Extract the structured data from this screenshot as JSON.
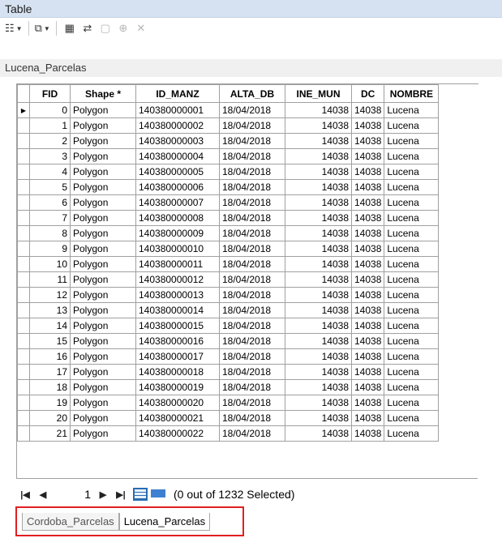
{
  "window": {
    "title": "Table"
  },
  "toolbar": {
    "items": [
      {
        "icon": "table-options-icon"
      },
      {
        "icon": "related-tables-icon"
      },
      {
        "icon": "select-by-attributes-icon"
      },
      {
        "icon": "switch-selection-icon"
      },
      {
        "icon": "clear-selection-icon"
      },
      {
        "icon": "zoom-to-selected-icon"
      },
      {
        "icon": "delete-selected-icon"
      }
    ]
  },
  "sheet": {
    "name": "Lucena_Parcelas"
  },
  "table": {
    "columns": [
      "FID",
      "Shape *",
      "ID_MANZ",
      "ALTA_DB",
      "INE_MUN",
      "DC",
      "NOMBRE"
    ],
    "rows": [
      [
        "0",
        "Polygon",
        "140380000001",
        "18/04/2018",
        "14038",
        "14038",
        "Lucena"
      ],
      [
        "1",
        "Polygon",
        "140380000002",
        "18/04/2018",
        "14038",
        "14038",
        "Lucena"
      ],
      [
        "2",
        "Polygon",
        "140380000003",
        "18/04/2018",
        "14038",
        "14038",
        "Lucena"
      ],
      [
        "3",
        "Polygon",
        "140380000004",
        "18/04/2018",
        "14038",
        "14038",
        "Lucena"
      ],
      [
        "4",
        "Polygon",
        "140380000005",
        "18/04/2018",
        "14038",
        "14038",
        "Lucena"
      ],
      [
        "5",
        "Polygon",
        "140380000006",
        "18/04/2018",
        "14038",
        "14038",
        "Lucena"
      ],
      [
        "6",
        "Polygon",
        "140380000007",
        "18/04/2018",
        "14038",
        "14038",
        "Lucena"
      ],
      [
        "7",
        "Polygon",
        "140380000008",
        "18/04/2018",
        "14038",
        "14038",
        "Lucena"
      ],
      [
        "8",
        "Polygon",
        "140380000009",
        "18/04/2018",
        "14038",
        "14038",
        "Lucena"
      ],
      [
        "9",
        "Polygon",
        "140380000010",
        "18/04/2018",
        "14038",
        "14038",
        "Lucena"
      ],
      [
        "10",
        "Polygon",
        "140380000011",
        "18/04/2018",
        "14038",
        "14038",
        "Lucena"
      ],
      [
        "11",
        "Polygon",
        "140380000012",
        "18/04/2018",
        "14038",
        "14038",
        "Lucena"
      ],
      [
        "12",
        "Polygon",
        "140380000013",
        "18/04/2018",
        "14038",
        "14038",
        "Lucena"
      ],
      [
        "13",
        "Polygon",
        "140380000014",
        "18/04/2018",
        "14038",
        "14038",
        "Lucena"
      ],
      [
        "14",
        "Polygon",
        "140380000015",
        "18/04/2018",
        "14038",
        "14038",
        "Lucena"
      ],
      [
        "15",
        "Polygon",
        "140380000016",
        "18/04/2018",
        "14038",
        "14038",
        "Lucena"
      ],
      [
        "16",
        "Polygon",
        "140380000017",
        "18/04/2018",
        "14038",
        "14038",
        "Lucena"
      ],
      [
        "17",
        "Polygon",
        "140380000018",
        "18/04/2018",
        "14038",
        "14038",
        "Lucena"
      ],
      [
        "18",
        "Polygon",
        "140380000019",
        "18/04/2018",
        "14038",
        "14038",
        "Lucena"
      ],
      [
        "19",
        "Polygon",
        "140380000020",
        "18/04/2018",
        "14038",
        "14038",
        "Lucena"
      ],
      [
        "20",
        "Polygon",
        "140380000021",
        "18/04/2018",
        "14038",
        "14038",
        "Lucena"
      ],
      [
        "21",
        "Polygon",
        "140380000022",
        "18/04/2018",
        "14038",
        "14038",
        "Lucena"
      ]
    ]
  },
  "navigation": {
    "current_record": "1",
    "status": "(0 out of 1232 Selected)"
  },
  "tabs": [
    {
      "label": "Cordoba_Parcelas",
      "active": false
    },
    {
      "label": "Lucena_Parcelas",
      "active": true
    }
  ],
  "colors": {
    "highlight_box": "#e02020",
    "view_button": "#2a6cb3"
  }
}
